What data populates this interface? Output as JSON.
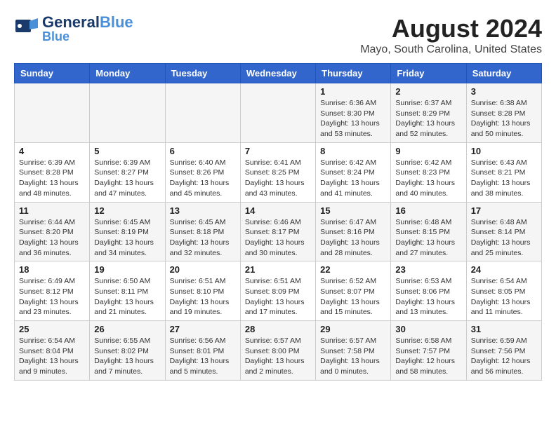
{
  "header": {
    "logo_line1": "General",
    "logo_line2": "Blue",
    "title": "August 2024",
    "subtitle": "Mayo, South Carolina, United States"
  },
  "weekdays": [
    "Sunday",
    "Monday",
    "Tuesday",
    "Wednesday",
    "Thursday",
    "Friday",
    "Saturday"
  ],
  "weeks": [
    [
      {
        "day": "",
        "info": ""
      },
      {
        "day": "",
        "info": ""
      },
      {
        "day": "",
        "info": ""
      },
      {
        "day": "",
        "info": ""
      },
      {
        "day": "1",
        "info": "Sunrise: 6:36 AM\nSunset: 8:30 PM\nDaylight: 13 hours\nand 53 minutes."
      },
      {
        "day": "2",
        "info": "Sunrise: 6:37 AM\nSunset: 8:29 PM\nDaylight: 13 hours\nand 52 minutes."
      },
      {
        "day": "3",
        "info": "Sunrise: 6:38 AM\nSunset: 8:28 PM\nDaylight: 13 hours\nand 50 minutes."
      }
    ],
    [
      {
        "day": "4",
        "info": "Sunrise: 6:39 AM\nSunset: 8:28 PM\nDaylight: 13 hours\nand 48 minutes."
      },
      {
        "day": "5",
        "info": "Sunrise: 6:39 AM\nSunset: 8:27 PM\nDaylight: 13 hours\nand 47 minutes."
      },
      {
        "day": "6",
        "info": "Sunrise: 6:40 AM\nSunset: 8:26 PM\nDaylight: 13 hours\nand 45 minutes."
      },
      {
        "day": "7",
        "info": "Sunrise: 6:41 AM\nSunset: 8:25 PM\nDaylight: 13 hours\nand 43 minutes."
      },
      {
        "day": "8",
        "info": "Sunrise: 6:42 AM\nSunset: 8:24 PM\nDaylight: 13 hours\nand 41 minutes."
      },
      {
        "day": "9",
        "info": "Sunrise: 6:42 AM\nSunset: 8:23 PM\nDaylight: 13 hours\nand 40 minutes."
      },
      {
        "day": "10",
        "info": "Sunrise: 6:43 AM\nSunset: 8:21 PM\nDaylight: 13 hours\nand 38 minutes."
      }
    ],
    [
      {
        "day": "11",
        "info": "Sunrise: 6:44 AM\nSunset: 8:20 PM\nDaylight: 13 hours\nand 36 minutes."
      },
      {
        "day": "12",
        "info": "Sunrise: 6:45 AM\nSunset: 8:19 PM\nDaylight: 13 hours\nand 34 minutes."
      },
      {
        "day": "13",
        "info": "Sunrise: 6:45 AM\nSunset: 8:18 PM\nDaylight: 13 hours\nand 32 minutes."
      },
      {
        "day": "14",
        "info": "Sunrise: 6:46 AM\nSunset: 8:17 PM\nDaylight: 13 hours\nand 30 minutes."
      },
      {
        "day": "15",
        "info": "Sunrise: 6:47 AM\nSunset: 8:16 PM\nDaylight: 13 hours\nand 28 minutes."
      },
      {
        "day": "16",
        "info": "Sunrise: 6:48 AM\nSunset: 8:15 PM\nDaylight: 13 hours\nand 27 minutes."
      },
      {
        "day": "17",
        "info": "Sunrise: 6:48 AM\nSunset: 8:14 PM\nDaylight: 13 hours\nand 25 minutes."
      }
    ],
    [
      {
        "day": "18",
        "info": "Sunrise: 6:49 AM\nSunset: 8:12 PM\nDaylight: 13 hours\nand 23 minutes."
      },
      {
        "day": "19",
        "info": "Sunrise: 6:50 AM\nSunset: 8:11 PM\nDaylight: 13 hours\nand 21 minutes."
      },
      {
        "day": "20",
        "info": "Sunrise: 6:51 AM\nSunset: 8:10 PM\nDaylight: 13 hours\nand 19 minutes."
      },
      {
        "day": "21",
        "info": "Sunrise: 6:51 AM\nSunset: 8:09 PM\nDaylight: 13 hours\nand 17 minutes."
      },
      {
        "day": "22",
        "info": "Sunrise: 6:52 AM\nSunset: 8:07 PM\nDaylight: 13 hours\nand 15 minutes."
      },
      {
        "day": "23",
        "info": "Sunrise: 6:53 AM\nSunset: 8:06 PM\nDaylight: 13 hours\nand 13 minutes."
      },
      {
        "day": "24",
        "info": "Sunrise: 6:54 AM\nSunset: 8:05 PM\nDaylight: 13 hours\nand 11 minutes."
      }
    ],
    [
      {
        "day": "25",
        "info": "Sunrise: 6:54 AM\nSunset: 8:04 PM\nDaylight: 13 hours\nand 9 minutes."
      },
      {
        "day": "26",
        "info": "Sunrise: 6:55 AM\nSunset: 8:02 PM\nDaylight: 13 hours\nand 7 minutes."
      },
      {
        "day": "27",
        "info": "Sunrise: 6:56 AM\nSunset: 8:01 PM\nDaylight: 13 hours\nand 5 minutes."
      },
      {
        "day": "28",
        "info": "Sunrise: 6:57 AM\nSunset: 8:00 PM\nDaylight: 13 hours\nand 2 minutes."
      },
      {
        "day": "29",
        "info": "Sunrise: 6:57 AM\nSunset: 7:58 PM\nDaylight: 13 hours\nand 0 minutes."
      },
      {
        "day": "30",
        "info": "Sunrise: 6:58 AM\nSunset: 7:57 PM\nDaylight: 12 hours\nand 58 minutes."
      },
      {
        "day": "31",
        "info": "Sunrise: 6:59 AM\nSunset: 7:56 PM\nDaylight: 12 hours\nand 56 minutes."
      }
    ]
  ]
}
